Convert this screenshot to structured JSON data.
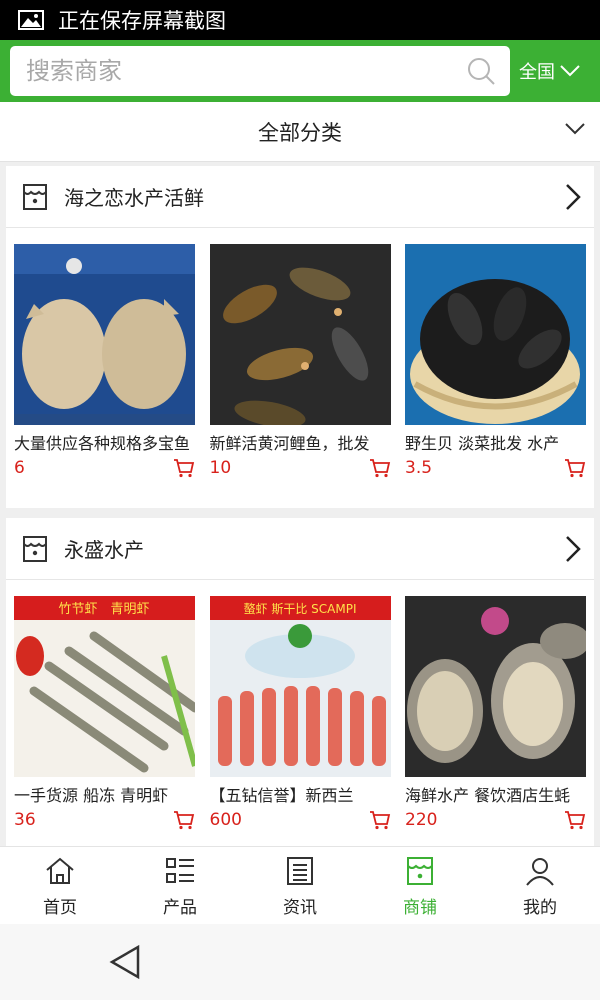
{
  "status_bar": {
    "text": "正在保存屏幕截图"
  },
  "search": {
    "placeholder": "搜索商家",
    "region": "全国"
  },
  "category": {
    "label": "全部分类"
  },
  "shops": [
    {
      "name": "海之恋水产活鲜",
      "products": [
        {
          "title": "大量供应各种规格多宝鱼",
          "price": "6"
        },
        {
          "title": "新鲜活黄河鲤鱼，批发",
          "price": "10"
        },
        {
          "title": "野生贝 淡菜批发 水产",
          "price": "3.5"
        }
      ]
    },
    {
      "name": "永盛水产",
      "products": [
        {
          "title": "一手货源 船冻 青明虾",
          "price": "36"
        },
        {
          "title": "【五钻信誉】新西兰",
          "price": "600"
        },
        {
          "title": "海鲜水产 餐饮酒店生蚝",
          "price": "220"
        }
      ]
    }
  ],
  "banners": {
    "shrimp": "竹节虾　青明虾",
    "scampi": "螯虾 斯干比 SCAMPI"
  },
  "tabs": [
    {
      "label": "首页",
      "icon": "home-icon"
    },
    {
      "label": "产品",
      "icon": "list-icon"
    },
    {
      "label": "资讯",
      "icon": "news-icon"
    },
    {
      "label": "商铺",
      "icon": "store-icon"
    },
    {
      "label": "我的",
      "icon": "user-icon"
    }
  ],
  "colors": {
    "brand_green": "#3cb034",
    "price_red": "#d8221c"
  }
}
